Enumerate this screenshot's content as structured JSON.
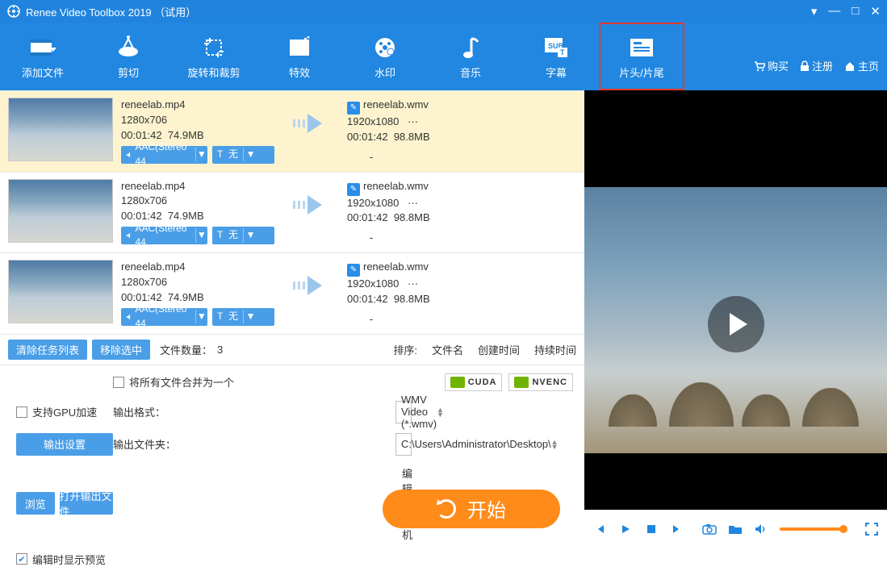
{
  "app": {
    "title": "Renee Video Toolbox 2019 （试用）"
  },
  "toolbar": {
    "items": [
      {
        "label": "添加文件"
      },
      {
        "label": "剪切"
      },
      {
        "label": "旋转和裁剪"
      },
      {
        "label": "特效"
      },
      {
        "label": "水印"
      },
      {
        "label": "音乐"
      },
      {
        "label": "字幕"
      },
      {
        "label": "片头/片尾"
      }
    ],
    "selected_index": 7,
    "rightlinks": {
      "buy": "购买",
      "register": "注册",
      "home": "主页"
    }
  },
  "files": [
    {
      "name": "reneelab.mp4",
      "res": "1280x706",
      "dur": "00:01:42",
      "size": "74.9MB",
      "audio": "AAC(Stereo 44",
      "sub": "无",
      "out_name": "reneelab.wmv",
      "out_res": "1920x1080",
      "out_more": "···",
      "out_dur": "00:01:42",
      "out_size": "98.8MB",
      "out_sub": "-"
    },
    {
      "name": "reneelab.mp4",
      "res": "1280x706",
      "dur": "00:01:42",
      "size": "74.9MB",
      "audio": "AAC(Stereo 44",
      "sub": "无",
      "out_name": "reneelab.wmv",
      "out_res": "1920x1080",
      "out_more": "···",
      "out_dur": "00:01:42",
      "out_size": "98.8MB",
      "out_sub": "-"
    },
    {
      "name": "reneelab.mp4",
      "res": "1280x706",
      "dur": "00:01:42",
      "size": "74.9MB",
      "audio": "AAC(Stereo 44",
      "sub": "无",
      "out_name": "reneelab.wmv",
      "out_res": "1920x1080",
      "out_more": "···",
      "out_dur": "00:01:42",
      "out_size": "98.8MB",
      "out_sub": "-"
    }
  ],
  "pill_labels": {
    "sub_prefix": "T"
  },
  "listbar": {
    "clear": "清除任务列表",
    "remove": "移除选中",
    "count_label": "文件数量：",
    "count": "3",
    "sort_label": "排序:",
    "by_name": "文件名",
    "by_created": "创建时间",
    "by_duration": "持续时间"
  },
  "options": {
    "merge": "将所有文件合并为一个",
    "gpu": "支持GPU加速",
    "cuda": "CUDA",
    "nvenc": "NVENC",
    "format_label": "输出格式：",
    "format_value": "WMV Video (*.wmv)",
    "settings_btn": "输出设置",
    "folder_label": "输出文件夹：",
    "folder_value": "C:\\Users\\Administrator\\Desktop\\",
    "browse": "浏览",
    "open_out": "打开输出文件",
    "shutdown": "编辑后关机",
    "preview_after": "编辑时显示预览"
  },
  "start_btn": "开始"
}
